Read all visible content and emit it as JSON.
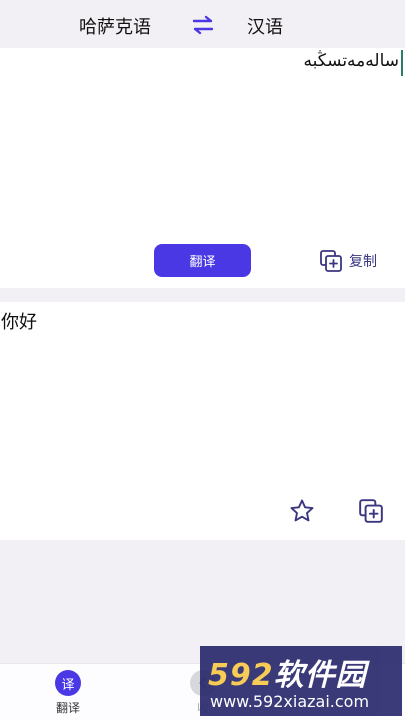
{
  "header": {
    "source_language": "哈萨克语",
    "target_language": "汉语",
    "swap_icon": "swap-arrows-icon"
  },
  "input": {
    "text": "ساله‌مه‌تسڭبه"
  },
  "actions": {
    "translate_label": "翻译",
    "copy_label": "复制"
  },
  "output": {
    "text": "你好"
  },
  "nav": {
    "translate_icon_text": "译",
    "translate_label": "翻译",
    "favorites_label": "收"
  },
  "watermark": {
    "logo_digits": "592",
    "logo_text": "软件园",
    "url": "www.592xiazai.com"
  },
  "colors": {
    "accent": "#4b38e5",
    "icon": "#3a3680",
    "background": "#f2f0f5"
  }
}
